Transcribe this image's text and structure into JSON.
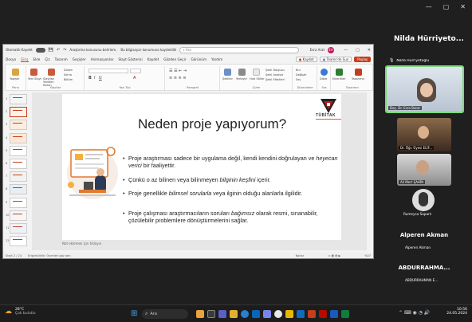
{
  "meeting": {
    "speaker_heading": "Nilda Hürriyeto...",
    "speaker_small": "Nilda Hürriyetoğlu"
  },
  "ppt": {
    "titlebar": {
      "autosave": "Otomatik Kaydet",
      "filename": "Araştırma konusunu belirlem...",
      "saved": "Bu bilgisayar konumuna kaydedildi",
      "search": "Ara",
      "user": "Esra Arat",
      "avatar": "EA"
    },
    "menu": [
      "Dosya",
      "Giriş",
      "Ekle",
      "Çiz",
      "Tasarım",
      "Geçişler",
      "Animasyonlar",
      "Slayt Gösterisi",
      "Kaydet",
      "Gözden Geçir",
      "Görünüm",
      "Yardım"
    ],
    "record_btn": "Kaydet",
    "teams_btn": "Teams'de Sun",
    "share_btn": "Paylaş",
    "ribbon": {
      "groups": [
        "Pano",
        "Slaytlar",
        "Yazı Tipi",
        "Paragraf",
        "Çizim",
        "Düzenleme",
        "Ses",
        "Tasarımcı"
      ],
      "items": [
        "Yapıştır",
        "Yeni Slayt",
        "Slaytları Yeniden Kullan",
        "Düzen",
        "Sıfırla",
        "Bölüm",
        "Şekiller",
        "Yerleştir",
        "Hızlı Stiller",
        "Şekil Dolgusu",
        "Şekil Anahat",
        "Şekil Efektleri",
        "Bul",
        "Değiştir",
        "Seç",
        "Dikte",
        "Eklentiler",
        "Tasarımcı"
      ]
    },
    "slide": {
      "title": "Neden proje yapıyorum?",
      "logo_text": "TÜBİTAK",
      "bullets": [
        {
          "parts": [
            {
              "t": "Proje araştırması sadece bir uygulama değil, kendi kendini doğrulayan ve ",
              "i": false
            },
            {
              "t": "heyecan verici",
              "i": true
            },
            {
              "t": " bir faaliyettir.",
              "i": false
            }
          ]
        },
        {
          "parts": [
            {
              "t": "Çünkü o az bilinen veya bilinmeyen ",
              "i": false
            },
            {
              "t": "bilginin keşfini",
              "i": true
            },
            {
              "t": " içerir.",
              "i": false
            }
          ]
        },
        {
          "parts": [
            {
              "t": "Proje genellikle ",
              "i": false
            },
            {
              "t": "bilimsel sorularla",
              "i": true
            },
            {
              "t": " veya ilginin olduğu alanlarla ilgilidir.",
              "i": false
            }
          ]
        },
        {
          "parts": [
            {
              "t": "Proje çalışması araştırmacıların soruları ",
              "i": false
            },
            {
              "t": "bağımsız",
              "i": true
            },
            {
              "t": " olarak resmi, sınanabilir, çözülebilir problemlere dönüştürmelerini sağlar.",
              "i": false
            }
          ]
        }
      ]
    },
    "notes": "Not eklemek için tıklayın",
    "status": {
      "slide": "Slayt 2 / 24",
      "accessibility": "Erişilebilirlik: Önerileri göz atın",
      "notes_btn": "Notlar",
      "zoom": "%47"
    },
    "thumb_numbers": [
      "1",
      "2",
      "3",
      "4",
      "5",
      "6",
      "7",
      "8",
      "9",
      "10",
      "11",
      "12"
    ]
  },
  "participants": [
    {
      "name": "Doç. Dr. Esra Bulut",
      "type": "video"
    },
    {
      "name": "Dr. Öğr. Üyesi ELİF...",
      "type": "video"
    },
    {
      "name": "Ali Mert ŞAHİN",
      "type": "video"
    },
    {
      "name": "Rumeysa Saparlı",
      "type": "avatar"
    },
    {
      "name": "Alperen Akman",
      "heading": "Alperen Akman",
      "type": "name"
    },
    {
      "name": "ABDURRAHMAN E...",
      "heading": "ABDURRAHMA...",
      "type": "name"
    }
  ],
  "taskbar": {
    "weather_temp": "28°C",
    "weather_desc": "Çok bulutlu",
    "search": "Ara",
    "time": "10:56",
    "date": "24.05.2024"
  }
}
